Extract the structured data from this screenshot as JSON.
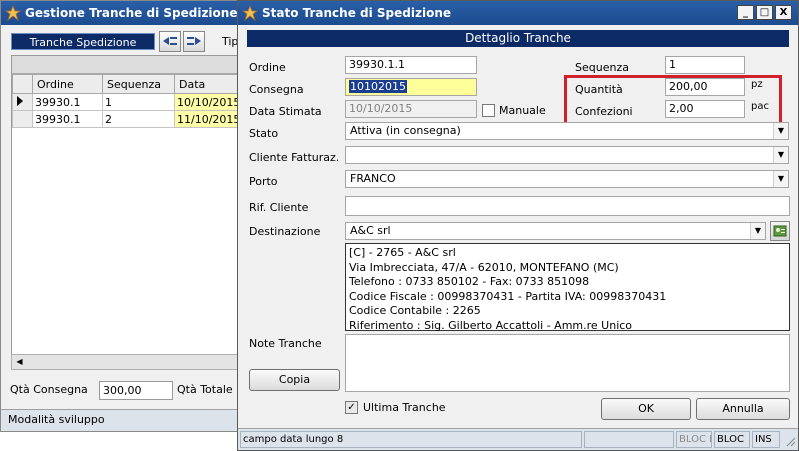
{
  "background_window": {
    "title": "Gestione Tranche di Spedizione",
    "tab_label": "Tranche Spedizione",
    "toolbar_tip": "Tip",
    "grid": {
      "columns": [
        "Ordine",
        "Sequenza",
        "Data"
      ],
      "rows": [
        {
          "ordine": "39930.1",
          "sequenza": "1",
          "data": "10/10/2015"
        },
        {
          "ordine": "39930.1",
          "sequenza": "2",
          "data": "11/10/2015"
        }
      ]
    },
    "qta_consegna_label": "Qtà Consegna",
    "qta_consegna_value": "300,00",
    "qta_totale_label": "Qtà Totale",
    "status_text": "Modalità sviluppo"
  },
  "dialog": {
    "title": "Stato Tranche di Spedizione",
    "window_buttons": {
      "minimize": "_",
      "maximize": "□",
      "close": "X"
    },
    "header": "Dettaglio Tranche",
    "fields": {
      "ordine_label": "Ordine",
      "ordine_value": "39930.1.1",
      "sequenza_label": "Sequenza",
      "sequenza_value": "1",
      "consegna_label": "Consegna",
      "consegna_value": "10102015",
      "quantita_label": "Quantità",
      "quantita_value": "200,00",
      "quantita_unit": "pz",
      "data_stimata_label": "Data Stimata",
      "data_stimata_value": "10/10/2015",
      "manuale_label": "Manuale",
      "confezioni_label": "Confezioni",
      "confezioni_value": "2,00",
      "confezioni_unit": "pac",
      "stato_label": "Stato",
      "stato_value": "Attiva (in consegna)",
      "cliente_label": "Cliente Fatturaz.",
      "cliente_value": "",
      "porto_label": "Porto",
      "porto_value": "FRANCO",
      "rif_label": "Rif. Cliente",
      "rif_value": "",
      "destinazione_label": "Destinazione",
      "destinazione_value": "A&C srl",
      "destinazione_details": [
        "[C] - 2765 - A&C srl",
        "Via Imbrecciata, 47/A - 62010, MONTEFANO (MC)",
        "Telefono : 0733 850102 - Fax: 0733 851098",
        "Codice Fiscale : 00998370431 - Partita IVA: 00998370431",
        "Codice Contabile : 2265",
        "Riferimento : Sig. Gilberto Accattoli - Amm.re Unico"
      ],
      "note_label": "Note Tranche"
    },
    "copia_button": "Copia",
    "ultima_tranche_label": "Ultima Tranche",
    "ultima_tranche_checked": true,
    "ok_button": "OK",
    "annulla_button": "Annulla",
    "status_bar": {
      "message": "campo data lungo 8",
      "cell_bloc1": "BLOC N",
      "cell_bloc2": "BLOC",
      "cell_ins": "INS"
    },
    "highlight_color": "#d0202a"
  },
  "colors": {
    "titlebar": "#1c4b8f",
    "header": "#0b2a66",
    "date_highlight": "#ffffa8",
    "consegna_highlight": "#ffff99"
  }
}
